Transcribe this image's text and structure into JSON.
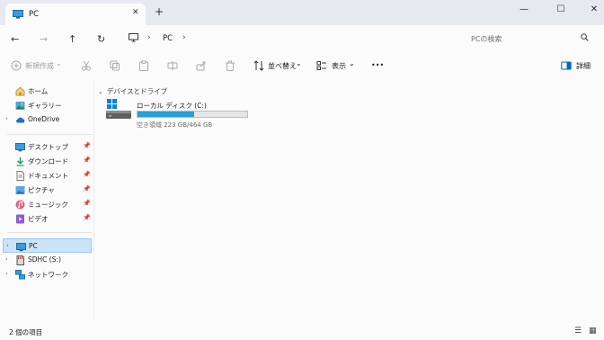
{
  "window": {
    "tab_title": "PC",
    "tab_close": "✕",
    "new_tab": "+",
    "minimize": "—",
    "maximize": "☐",
    "close": "✕"
  },
  "address": {
    "back": "←",
    "forward": "→",
    "up": "↑",
    "refresh": "↻",
    "sep1": "›",
    "crumb_pc": "PC",
    "sep2": "›",
    "search_placeholder": "PCの検索"
  },
  "command_bar": {
    "new_label": "新規作成",
    "new_chevron": "⌄",
    "sort_label": "並べ替え",
    "sort_chevron": "⌄",
    "view_label": "表示",
    "view_chevron": "⌄",
    "more": "•••",
    "details_label": "詳細"
  },
  "sidebar": {
    "home": "ホーム",
    "gallery": "ギャラリー",
    "onedrive": "OneDrive",
    "desktop": "デスクトップ",
    "downloads": "ダウンロード",
    "documents": "ドキュメント",
    "pictures": "ピクチャ",
    "music": "ミュージック",
    "videos": "ビデオ",
    "pc": "PC",
    "sdhc": "SDHC (S:)",
    "network": "ネットワーク",
    "chevron": "›",
    "pin": "📌"
  },
  "main": {
    "group_title": "デバイスとドライブ",
    "group_chevron": "⌄",
    "drive_name": "ローカル ディスク (C:)",
    "drive_free": "空き領域 223 GB/464 GB",
    "drive_used_fraction": 0.52
  },
  "status": {
    "item_count": "2 個の項目",
    "list_view": "☰",
    "tile_view": "▦"
  },
  "colors": {
    "accent": "#0067c0",
    "selection": "#cce4f7",
    "drive_fill": "#26a0da"
  }
}
